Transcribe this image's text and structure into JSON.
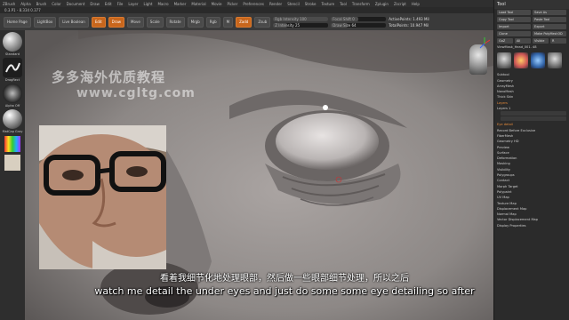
{
  "menubar": {
    "items": [
      "ZBrush",
      "Alpha",
      "Brush",
      "Color",
      "Document",
      "Draw",
      "Edit",
      "File",
      "Layer",
      "Light",
      "Macro",
      "Marker",
      "Material",
      "Movie",
      "Picker",
      "Preferences",
      "Render",
      "Stencil",
      "Stroke",
      "Texture",
      "Tool",
      "Transform",
      "Zplugin",
      "Zscript",
      "Help"
    ]
  },
  "statusline": {
    "text": "0.3.P1 - 8.334 0.377"
  },
  "toolbar": {
    "buttons": [
      "Home Page",
      "LightBox",
      "Live Boolean",
      "Edit",
      "Draw",
      "Move",
      "Scale",
      "Rotate"
    ],
    "mrgb": "Mrgb",
    "rgb": "Rgb",
    "m": "M",
    "zadd": "Zadd",
    "zsub": "Zsub",
    "focal_label": "Focal Shift 0",
    "draw_size_label": "Draw Size 64",
    "rgb_int_label": "Rgb Intensity 100",
    "z_int_label": "Z Intensity 25",
    "active_points": "ActivePoints: 1.493 Mil",
    "total_points": "TotalPoints: 10.947 Mil"
  },
  "left_tray": {
    "brush1": "Standard",
    "brush2": "DragRect",
    "brush3": "Alpha Off",
    "material": "MatCap Gray"
  },
  "watermark": {
    "line1": "多多海外优质教程",
    "line2": "www.cgltg.com"
  },
  "right_panel": {
    "title": "Tool",
    "buttons": [
      "Load Tool",
      "Save As",
      "Copy Tool",
      "Paste Tool",
      "Import",
      "Export",
      "Clone",
      "Make PolyMesh3D",
      "GoZ",
      "All",
      "Visible",
      "R"
    ],
    "tool_name": "ViewMask_Head_001. 48",
    "thumb_labels": [
      "Cylinder3D",
      "PolyMesh3D",
      "SimpleBrush",
      "ViewMask"
    ],
    "sections": [
      "Subtool",
      "Geometry",
      "ArrayMesh",
      "NanoMesh",
      "Thick Skin",
      "Layers",
      "FiberMesh",
      "Geometry HD",
      "Preview",
      "Surface",
      "Deformation",
      "Masking",
      "Visibility",
      "Polygroups",
      "Contact",
      "Morph Target",
      "Polypaint",
      "UV Map",
      "Texture Map",
      "Displacement Map",
      "Normal Map",
      "Vector Displacement Map",
      "Display Properties"
    ],
    "layers_label": "Layers 1",
    "layer_name": "Eye detail",
    "record_label": "Record Before Exclusive"
  },
  "subtitles": {
    "chinese": "看着我细节化地处理眼部，然后做一些眼部细节处理，所以之后",
    "english": "watch me detail the under eyes and just do some some eye detailing so after"
  },
  "colors": {
    "accent": "#c8661c",
    "panel": "#2b2b2b",
    "viewport": "#8c8786"
  },
  "icons": [
    "zbrush-logo-icon",
    "brush-sphere-icon",
    "stroke-icon",
    "alpha-icon",
    "material-sphere-icon",
    "color-picker-icon",
    "head-gizmo-icon",
    "axis-gizmo-icon"
  ]
}
